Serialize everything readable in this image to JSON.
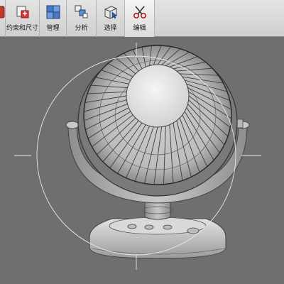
{
  "toolbar": {
    "items": [
      {
        "label": "",
        "icon": "constraint-icon"
      },
      {
        "label": "约束和尺寸",
        "icon": "constraints-dimensions-icon"
      },
      {
        "label": "管理",
        "icon": "manage-icon"
      },
      {
        "label": "分析",
        "icon": "analyze-icon"
      },
      {
        "label": "选择",
        "icon": "select-icon"
      },
      {
        "label": "编辑",
        "icon": "scissors-icon"
      }
    ]
  },
  "viewport": {
    "model": "desk-fan",
    "background_color": "#6f6f6f"
  }
}
